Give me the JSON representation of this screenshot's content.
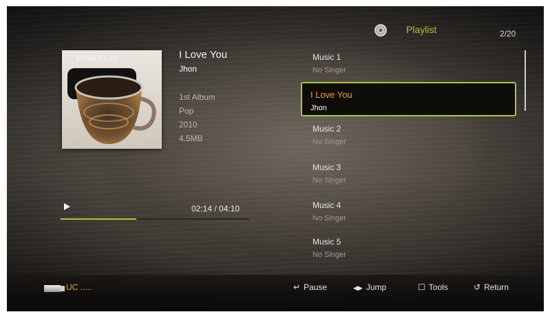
{
  "header": {
    "playlist_label": "Playlist",
    "counter": "2/20",
    "disc_icon": "disc-icon"
  },
  "now_playing": {
    "art_overlay": "Movie 01.avi",
    "title": "I Love You",
    "artist": "Jhon",
    "album": "1st Album",
    "genre": "Pop",
    "year": "2010",
    "size": "4.5MB",
    "time": "02:14 / 04:10",
    "progress": 0.4
  },
  "playlist": {
    "items": [
      {
        "title": "Music 1",
        "sub": "No Singer"
      },
      {
        "title": "I Love You",
        "sub": "Jhon",
        "selected": true
      },
      {
        "title": "Music 2",
        "sub": "No Singer"
      },
      {
        "title": "Music 3",
        "sub": "No Singer"
      },
      {
        "title": "Music 4",
        "sub": "No Singer"
      },
      {
        "title": "Music 5",
        "sub": "No Singer"
      }
    ]
  },
  "footer": {
    "device": "UC .....",
    "pause": "Pause",
    "jump": "Jump",
    "tools": "Tools",
    "return": "Return",
    "pause_icon": "↵",
    "jump_icon": "◀▶",
    "tools_icon": "☐",
    "return_icon": "↺"
  },
  "colors": {
    "accent": "#a8c83a",
    "highlight": "#e8a13a"
  }
}
